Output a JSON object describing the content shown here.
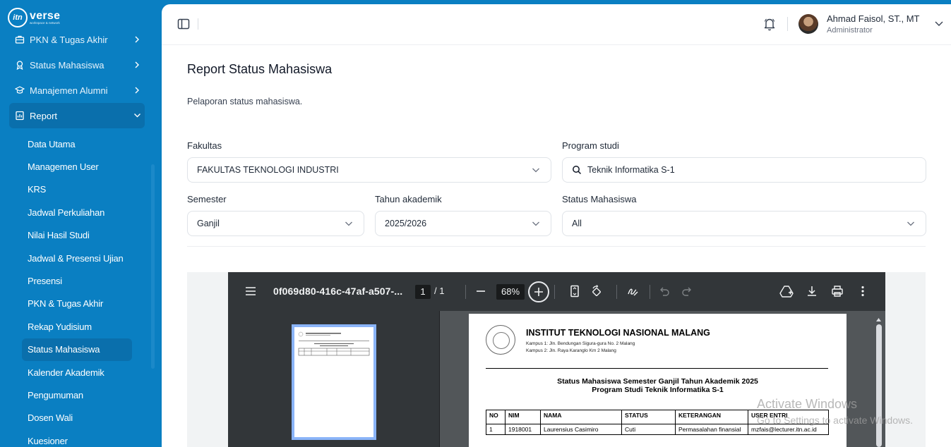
{
  "brand": {
    "name": "verse",
    "mark": "itn",
    "tagline": "workspace & network"
  },
  "sidebar": {
    "items": [
      {
        "label": "PKN & Tugas Akhir",
        "icon": "briefcase-icon"
      },
      {
        "label": "Status Mahasiswa",
        "icon": "award-icon"
      },
      {
        "label": "Manajemen Alumni",
        "icon": "grad-icon"
      },
      {
        "label": "Report",
        "icon": "report-icon"
      }
    ],
    "report_submenu": [
      "Data Utama",
      "Managemen User",
      "KRS",
      "Jadwal Perkuliahan",
      "Nilai Hasil Studi",
      "Jadwal & Presensi Ujian",
      "Presensi",
      "PKN & Tugas Akhir",
      "Rekap Yudisium",
      "Status Mahasiswa",
      "Kalender Akademik",
      "Pengumuman",
      "Dosen Wali",
      "Kuesioner"
    ],
    "active_sub": "Status Mahasiswa"
  },
  "user": {
    "name": "Ahmad Faisol, ST., MT",
    "role": "Administrator"
  },
  "page": {
    "title": "Report Status Mahasiswa",
    "subtitle": "Pelaporan status mahasiswa."
  },
  "filters": {
    "fakultas": {
      "label": "Fakultas",
      "value": "FAKULTAS TEKNOLOGI INDUSTRI"
    },
    "prodi": {
      "label": "Program studi",
      "value": "Teknik Informatika S-1"
    },
    "semester": {
      "label": "Semester",
      "value": "Ganjil"
    },
    "tahun": {
      "label": "Tahun akademik",
      "value": "2025/2026"
    },
    "status": {
      "label": "Status Mahasiswa",
      "value": "All"
    }
  },
  "pdf": {
    "filename": "0f069d80-416c-47af-a507-...",
    "page_current": "1",
    "page_total": "/ 1",
    "zoom": "68%",
    "doc": {
      "institution": "INSTITUT TEKNOLOGI NASIONAL MALANG",
      "address1": "Kampus 1: Jln. Bendungan Sigura-gura No. 2 Malang",
      "address2": "Kampus 2: Jln. Raya Karanglo Km 2 Malang",
      "title1": "Status Mahasiswa Semester Ganjil Tahun Akademik 2025",
      "title2": "Program Studi Teknik Informatika S-1",
      "columns": [
        "NO",
        "NIM",
        "NAMA",
        "STATUS",
        "KETERANGAN",
        "USER ENTRI"
      ],
      "rows": [
        [
          "1",
          "1918001",
          "Laurensius Casimiro",
          "Cuti",
          "Permasalahan finansial",
          "mzfais@lecturer.itn.ac.id"
        ]
      ]
    }
  },
  "watermark": {
    "line1": "Activate Windows",
    "line2": "Go to Settings to activate Windows."
  }
}
